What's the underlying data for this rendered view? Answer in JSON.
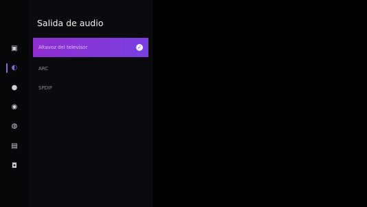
{
  "screen": {
    "title": "Salida de audio",
    "options": [
      {
        "label": "Altavoz del televisor",
        "selected": true
      },
      {
        "label": "ARC",
        "selected": false
      },
      {
        "label": "SPDIF",
        "selected": false
      }
    ],
    "selected_mark": "✓"
  },
  "rail": {
    "items": [
      {
        "icon": "picture-icon",
        "glyph": "▣"
      },
      {
        "icon": "sound-icon",
        "glyph": "◐",
        "active": true
      },
      {
        "icon": "network-icon",
        "glyph": "●"
      },
      {
        "icon": "system-icon",
        "glyph": "◉"
      },
      {
        "icon": "accessibility-icon",
        "glyph": "◍"
      },
      {
        "icon": "apps-icon",
        "glyph": "▤"
      },
      {
        "icon": "support-icon",
        "glyph": "◘"
      }
    ]
  },
  "colors": {
    "accent": "#8f2ed0",
    "accent_end": "#7a3fe0",
    "background": "#000000",
    "panel": "#0b0b0f"
  }
}
